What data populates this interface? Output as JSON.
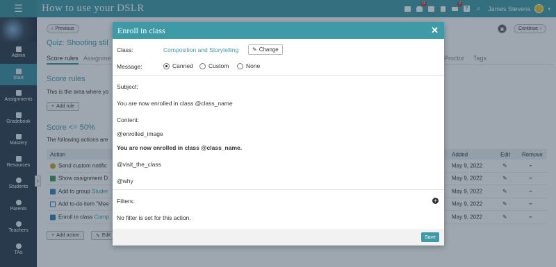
{
  "app": {
    "title": "How to use your DSLR"
  },
  "topbar": {
    "notif_badge_1": "11",
    "notif_badge_2": "2",
    "user_name": "James Stevens"
  },
  "sidebar": {
    "items": [
      {
        "label": "Admin"
      },
      {
        "label": "Start"
      },
      {
        "label": "Assignments"
      },
      {
        "label": "Gradebook"
      },
      {
        "label": "Mastery"
      },
      {
        "label": "Resources"
      },
      {
        "label": "Students"
      },
      {
        "label": "Parents"
      },
      {
        "label": "Teachers"
      },
      {
        "label": "TAs"
      }
    ]
  },
  "main": {
    "previous_label": "Previous",
    "continue_label": "Continue",
    "quiz_title": "Quiz: Shooting stil",
    "tabs": [
      "Score rules",
      "Assignme",
      "Proctor",
      "Tags"
    ],
    "score_rules_heading": "Score rules",
    "score_rules_desc": "This is the area where yo",
    "add_rule_label": "Add rule",
    "score_heading": "Score <= 50%",
    "following_actions": "The following actions are",
    "table": {
      "headers": {
        "action": "Action",
        "added": "Added",
        "edit": "Edit",
        "remove": "Remove"
      },
      "rows": [
        {
          "action": "Send custom notific",
          "link": "",
          "added": "May 9, 2022"
        },
        {
          "action": "Show assignment D",
          "link": "",
          "added": "May 9, 2022"
        },
        {
          "action": "Add to group ",
          "link": "Studer",
          "added": "May 9, 2022"
        },
        {
          "action": "Add to-do item \"Mee",
          "link": "",
          "added": "May 9, 2022"
        },
        {
          "action": "Enroll in class ",
          "link": "Comp",
          "added": "May 9, 2022"
        }
      ]
    },
    "add_action_label": "Add action",
    "edit_label": "Edit"
  },
  "modal": {
    "title": "Enroll in class",
    "class_label": "Class:",
    "class_value": "Composition and Storytelling",
    "change_label": "Change",
    "message_label": "Message:",
    "message_options": [
      "Canned",
      "Custom",
      "None"
    ],
    "message_selected": "Canned",
    "subject_label": "Subject:",
    "subject_value": "You are now enrolled in class @class_name",
    "content_label": "Content:",
    "content_lines": [
      "@enrolled_image",
      "You are now enrolled in class @class_name.",
      "@visit_the_class",
      "@why"
    ],
    "filters_label": "Filters:",
    "filters_empty": "No filter is set for this action.",
    "save_label": "Save"
  },
  "colors": {
    "accent": "#3d9aa6",
    "sidebar": "#2b3a4a"
  }
}
